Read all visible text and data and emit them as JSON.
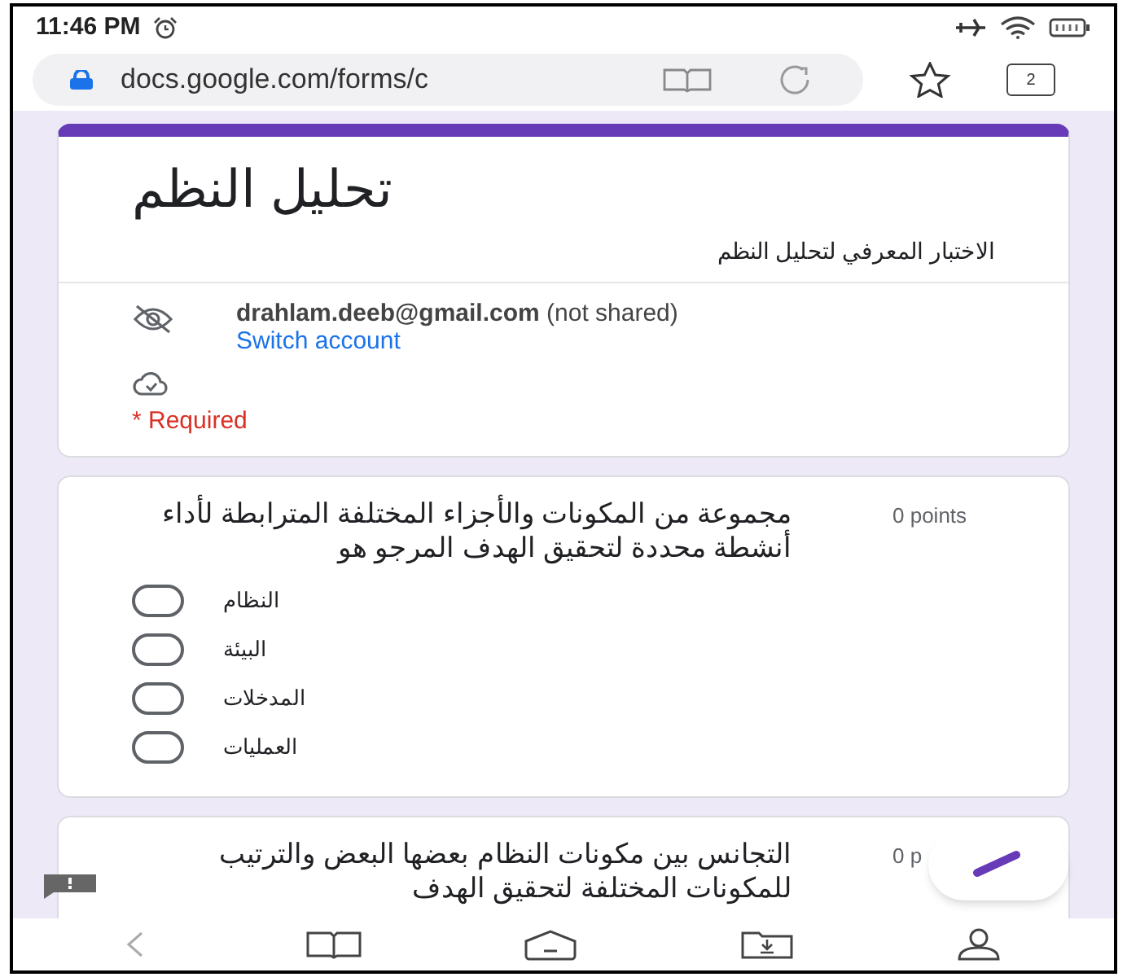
{
  "status_bar": {
    "time": "11:46 PM"
  },
  "browser": {
    "url": "docs.google.com/forms/c",
    "tab_count": "2"
  },
  "form_header": {
    "title": "تحليل النظم",
    "description": "الاختبار المعرفي لتحليل النظم",
    "email": "drahlam.deeb@gmail.com",
    "email_note": "(not shared)",
    "switch_account": "Switch account",
    "required_note": "* Required"
  },
  "questions": [
    {
      "text": "مجموعة من المكونات والأجزاء المختلفة المترابطة لأداء أنشطة محددة لتحقيق الهدف المرجو هو",
      "points": "0 points",
      "options": [
        {
          "label": "النظام",
          "selected": false
        },
        {
          "label": "البيئة",
          "selected": false
        },
        {
          "label": "المدخلات",
          "selected": false
        },
        {
          "label": "العمليات",
          "selected": false
        }
      ]
    },
    {
      "text": "التجانس بين مكونات النظام بعضها البعض والترتيب للمكونات المختلفة لتحقيق الهدف",
      "points": "0 p"
    }
  ]
}
